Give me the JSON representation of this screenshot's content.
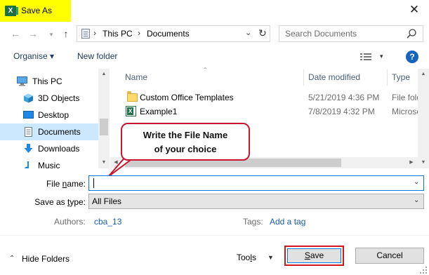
{
  "window": {
    "title": "Save As",
    "close_glyph": "✕",
    "app_icon_letter": "X"
  },
  "address": {
    "crumbs": [
      "This PC",
      "Documents"
    ],
    "search_placeholder": "Search Documents"
  },
  "toolbar": {
    "organise_label": "Organise ▾",
    "new_folder_label": "New folder",
    "help_label": "?"
  },
  "nav": {
    "items": [
      {
        "label": "This PC",
        "icon": "pc-icon"
      },
      {
        "label": "3D Objects",
        "icon": "cube-icon"
      },
      {
        "label": "Desktop",
        "icon": "desktop-icon"
      },
      {
        "label": "Documents",
        "icon": "documents-icon"
      },
      {
        "label": "Downloads",
        "icon": "download-arrow-icon"
      },
      {
        "label": "Music",
        "icon": "music-note-icon"
      }
    ],
    "selected": "Documents"
  },
  "list": {
    "columns": [
      "Name",
      "Date modified",
      "Type"
    ],
    "rows": [
      {
        "name": "Custom Office Templates",
        "date": "5/21/2019 4:36 PM",
        "type": "File folder",
        "icon": "folder-icon"
      },
      {
        "name": "Example1",
        "date": "7/8/2019 4:32 PM",
        "type": "Microsoft",
        "icon": "excel-file-icon"
      }
    ]
  },
  "callout": {
    "line1": "Write the File Name",
    "line2": "of your choice",
    "border_color": "#c8162e"
  },
  "form": {
    "file_name_label_pre": "File ",
    "file_name_label_ul": "n",
    "file_name_label_post": "ame:",
    "file_name_value": "",
    "save_as_type_label_pre": "Save as ",
    "save_as_type_label_ul": "t",
    "save_as_type_label_post": "ype:",
    "save_as_type_value": "All Files",
    "authors_label": "Authors:",
    "authors_value": "cba_13",
    "tags_label": "Tags:",
    "tags_value": "Add a tag"
  },
  "footer": {
    "hide_folders_label": "Hide Folders",
    "tools_label_pre": "Too",
    "tools_label_ul": "l",
    "tools_label_post": "s",
    "save_label_ul": "S",
    "save_label_post": "ave",
    "cancel_label": "Cancel"
  },
  "colors": {
    "title_highlight": "#ffff00",
    "accent": "#0078d7",
    "selection": "#cce8ff",
    "save_highlight": "#d2161e"
  }
}
